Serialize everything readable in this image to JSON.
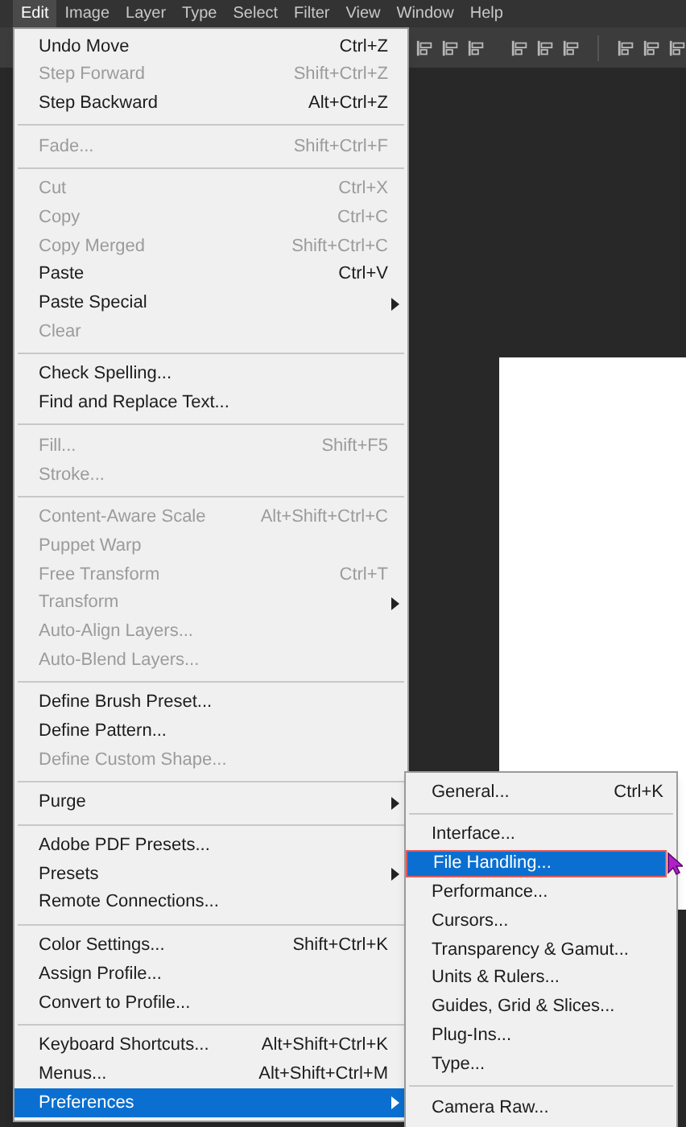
{
  "menu_bar": [
    {
      "label": "Edit",
      "selected": true
    },
    {
      "label": "Image",
      "selected": false
    },
    {
      "label": "Layer",
      "selected": false
    },
    {
      "label": "Type",
      "selected": false
    },
    {
      "label": "Select",
      "selected": false
    },
    {
      "label": "Filter",
      "selected": false
    },
    {
      "label": "View",
      "selected": false
    },
    {
      "label": "Window",
      "selected": false
    },
    {
      "label": "Help",
      "selected": false
    }
  ],
  "edit_menu": {
    "groups": [
      [
        {
          "label": "Undo Move",
          "shortcut": "Ctrl+Z",
          "disabled": false,
          "selected": false,
          "submenu": false
        },
        {
          "label": "Step Forward",
          "shortcut": "Shift+Ctrl+Z",
          "disabled": true,
          "selected": false,
          "submenu": false
        },
        {
          "label": "Step Backward",
          "shortcut": "Alt+Ctrl+Z",
          "disabled": false,
          "selected": false,
          "submenu": false
        }
      ],
      [
        {
          "label": "Fade...",
          "shortcut": "Shift+Ctrl+F",
          "disabled": true,
          "selected": false,
          "submenu": false
        }
      ],
      [
        {
          "label": "Cut",
          "shortcut": "Ctrl+X",
          "disabled": true,
          "selected": false,
          "submenu": false
        },
        {
          "label": "Copy",
          "shortcut": "Ctrl+C",
          "disabled": true,
          "selected": false,
          "submenu": false
        },
        {
          "label": "Copy Merged",
          "shortcut": "Shift+Ctrl+C",
          "disabled": true,
          "selected": false,
          "submenu": false
        },
        {
          "label": "Paste",
          "shortcut": "Ctrl+V",
          "disabled": false,
          "selected": false,
          "submenu": false
        },
        {
          "label": "Paste Special",
          "disabled": false,
          "selected": false,
          "submenu": true
        },
        {
          "label": "Clear",
          "disabled": true,
          "selected": false,
          "submenu": false
        }
      ],
      [
        {
          "label": "Check Spelling...",
          "disabled": false,
          "selected": false,
          "submenu": false
        },
        {
          "label": "Find and Replace Text...",
          "disabled": false,
          "selected": false,
          "submenu": false
        }
      ],
      [
        {
          "label": "Fill...",
          "shortcut": "Shift+F5",
          "disabled": true,
          "selected": false,
          "submenu": false
        },
        {
          "label": "Stroke...",
          "disabled": true,
          "selected": false,
          "submenu": false
        }
      ],
      [
        {
          "label": "Content-Aware Scale",
          "shortcut": "Alt+Shift+Ctrl+C",
          "disabled": true,
          "selected": false,
          "submenu": false
        },
        {
          "label": "Puppet Warp",
          "disabled": true,
          "selected": false,
          "submenu": false
        },
        {
          "label": "Free Transform",
          "shortcut": "Ctrl+T",
          "disabled": true,
          "selected": false,
          "submenu": false
        },
        {
          "label": "Transform",
          "disabled": true,
          "selected": false,
          "submenu": true
        },
        {
          "label": "Auto-Align Layers...",
          "disabled": true,
          "selected": false,
          "submenu": false
        },
        {
          "label": "Auto-Blend Layers...",
          "disabled": true,
          "selected": false,
          "submenu": false
        }
      ],
      [
        {
          "label": "Define Brush Preset...",
          "disabled": false,
          "selected": false,
          "submenu": false
        },
        {
          "label": "Define Pattern...",
          "disabled": false,
          "selected": false,
          "submenu": false
        },
        {
          "label": "Define Custom Shape...",
          "disabled": true,
          "selected": false,
          "submenu": false
        }
      ],
      [
        {
          "label": "Purge",
          "disabled": false,
          "selected": false,
          "submenu": true
        }
      ],
      [
        {
          "label": "Adobe PDF Presets...",
          "disabled": false,
          "selected": false,
          "submenu": false
        },
        {
          "label": "Presets",
          "disabled": false,
          "selected": false,
          "submenu": true
        },
        {
          "label": "Remote Connections...",
          "disabled": false,
          "selected": false,
          "submenu": false
        }
      ],
      [
        {
          "label": "Color Settings...",
          "shortcut": "Shift+Ctrl+K",
          "disabled": false,
          "selected": false,
          "submenu": false
        },
        {
          "label": "Assign Profile...",
          "disabled": false,
          "selected": false,
          "submenu": false
        },
        {
          "label": "Convert to Profile...",
          "disabled": false,
          "selected": false,
          "submenu": false
        }
      ],
      [
        {
          "label": "Keyboard Shortcuts...",
          "shortcut": "Alt+Shift+Ctrl+K",
          "disabled": false,
          "selected": false,
          "submenu": false
        },
        {
          "label": "Menus...",
          "shortcut": "Alt+Shift+Ctrl+M",
          "disabled": false,
          "selected": false,
          "submenu": false
        },
        {
          "label": "Preferences",
          "disabled": false,
          "selected": true,
          "submenu": true
        }
      ]
    ]
  },
  "preferences_submenu": {
    "groups": [
      [
        {
          "label": "General...",
          "shortcut": "Ctrl+K",
          "selected": false
        }
      ],
      [
        {
          "label": "Interface...",
          "selected": false
        },
        {
          "label": "File Handling...",
          "selected": true
        },
        {
          "label": "Performance...",
          "selected": false
        },
        {
          "label": "Cursors...",
          "selected": false
        },
        {
          "label": "Transparency & Gamut...",
          "selected": false
        },
        {
          "label": "Units & Rulers...",
          "selected": false
        },
        {
          "label": "Guides, Grid & Slices...",
          "selected": false
        },
        {
          "label": "Plug-Ins...",
          "selected": false
        },
        {
          "label": "Type...",
          "selected": false
        }
      ],
      [
        {
          "label": "Camera Raw...",
          "selected": false
        }
      ]
    ]
  }
}
